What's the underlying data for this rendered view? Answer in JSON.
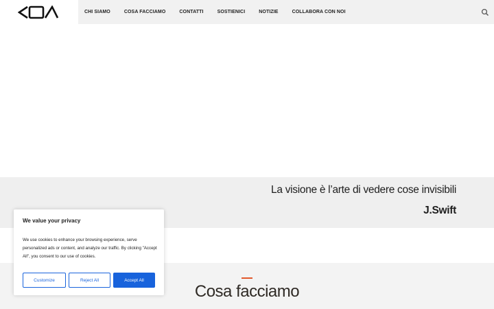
{
  "header": {
    "nav": [
      {
        "label": "CHI SIAMO"
      },
      {
        "label": "COSA FACCIAMO"
      },
      {
        "label": "CONTATTI"
      },
      {
        "label": "SOSTIENICI"
      },
      {
        "label": "NOTIZIE"
      },
      {
        "label": "COLLABORA CON NOI"
      }
    ],
    "search_icon": "search-icon",
    "logo_icon": "logo-icon"
  },
  "quote": {
    "text": "La visione è l’arte di vedere cose invisibili",
    "author": "J.Swift"
  },
  "section": {
    "title": "Cosa facciamo",
    "accent_color": "#e2582a"
  },
  "cookie_banner": {
    "title": "We value your privacy",
    "body": "We use cookies to enhance your browsing experience, serve personalized ads or content, and analyze our traffic. By clicking \"Accept All\", you consent to our use of cookies.",
    "customize_label": "Customize",
    "reject_label": "Reject All",
    "accept_label": "Accept All",
    "button_color": "#1863dc"
  }
}
